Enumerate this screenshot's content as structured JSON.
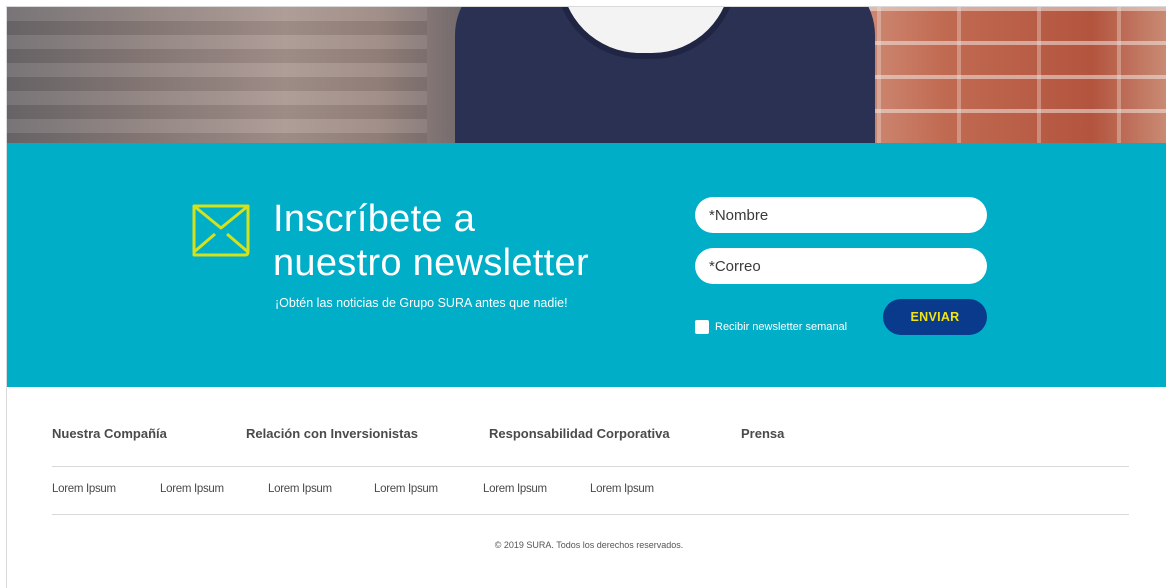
{
  "newsletter": {
    "title_line1": "Inscríbete a",
    "title_line2": "nuestro newsletter",
    "subtitle": "¡Obtén las noticias de Grupo SURA antes que nadie!",
    "name_placeholder": "*Nombre",
    "email_placeholder": "*Correo",
    "checkbox_label": "Recibir newsletter semanal",
    "submit_label": "ENVIAR",
    "icon": "envelope-icon",
    "colors": {
      "band": "#00aec7",
      "icon": "#d4e21b",
      "button": "#0a3a8c",
      "button_text": "#f2e414"
    }
  },
  "footer": {
    "nav": [
      "Nuestra Compañía",
      "Relación con Inversionistas",
      "Responsabilidad Corporativa",
      "Prensa"
    ],
    "links": [
      "Lorem Ipsum",
      "Lorem Ipsum",
      "Lorem Ipsum",
      "Lorem Ipsum",
      "Lorem Ipsum",
      "Lorem Ipsum"
    ],
    "copyright": "© 2019 SURA. Todos los derechos reservados."
  }
}
